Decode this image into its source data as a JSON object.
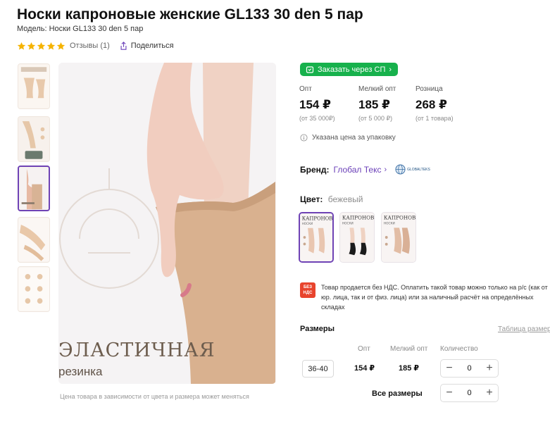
{
  "product": {
    "title": "Носки капроновые женские GL133 30 den 5 пар",
    "model_label": "Модель:",
    "model_value": "Носки GL133 30 den 5 пар",
    "rating_stars": 5,
    "reviews": "Отзывы (1)",
    "share": "Поделиться"
  },
  "gallery": {
    "active_thumb_index": 2,
    "thumb_count": 5,
    "image_text_line1": "ЭЛАСТИЧНАЯ",
    "image_text_line2": "резинка",
    "caption": "Цена товара в зависимости от цвета и размера может меняться"
  },
  "order_button": "Заказать через СП",
  "prices": [
    {
      "label": "Опт",
      "value": "154 ₽",
      "sub": "(от 35 000₽)"
    },
    {
      "label": "Мелкий опт",
      "value": "185 ₽",
      "sub": "(от 5 000 ₽)"
    },
    {
      "label": "Розница",
      "value": "268 ₽",
      "sub": "(от 1 товара)"
    }
  ],
  "price_note": "Указана цена за упаковку",
  "brand": {
    "label": "Бренд:",
    "name": "Глобал Текс",
    "logo_text": "GLOBALTEKS"
  },
  "color": {
    "label": "Цвет:",
    "value": "бежевый",
    "swatch_text": "КАПРОНОВЫЕ",
    "swatch_sub": "НОСКИ"
  },
  "vat": {
    "badge_line1": "БЕЗ",
    "badge_line2": "НДС",
    "text": "Товар продается без НДС. Оплатить такой товар можно только на р/с (как от юр. лица, так и от физ. лица) или за наличный расчёт на определённых складах"
  },
  "sizes": {
    "title": "Размеры",
    "table_link": "Таблица размеров",
    "headers": {
      "opt": "Опт",
      "small_opt": "Мелкий опт",
      "quantity": "Количество"
    },
    "rows": [
      {
        "size": "36-40",
        "opt": "154 ₽",
        "small_opt": "185 ₽",
        "qty": "0"
      }
    ],
    "all_sizes_label": "Все размеры",
    "all_sizes_qty": "0",
    "minus": "−",
    "plus": "+"
  },
  "colors": {
    "accent": "#6f43b5",
    "order_green": "#17b14c",
    "star": "#f5b301",
    "vat_red": "#e8442d"
  }
}
